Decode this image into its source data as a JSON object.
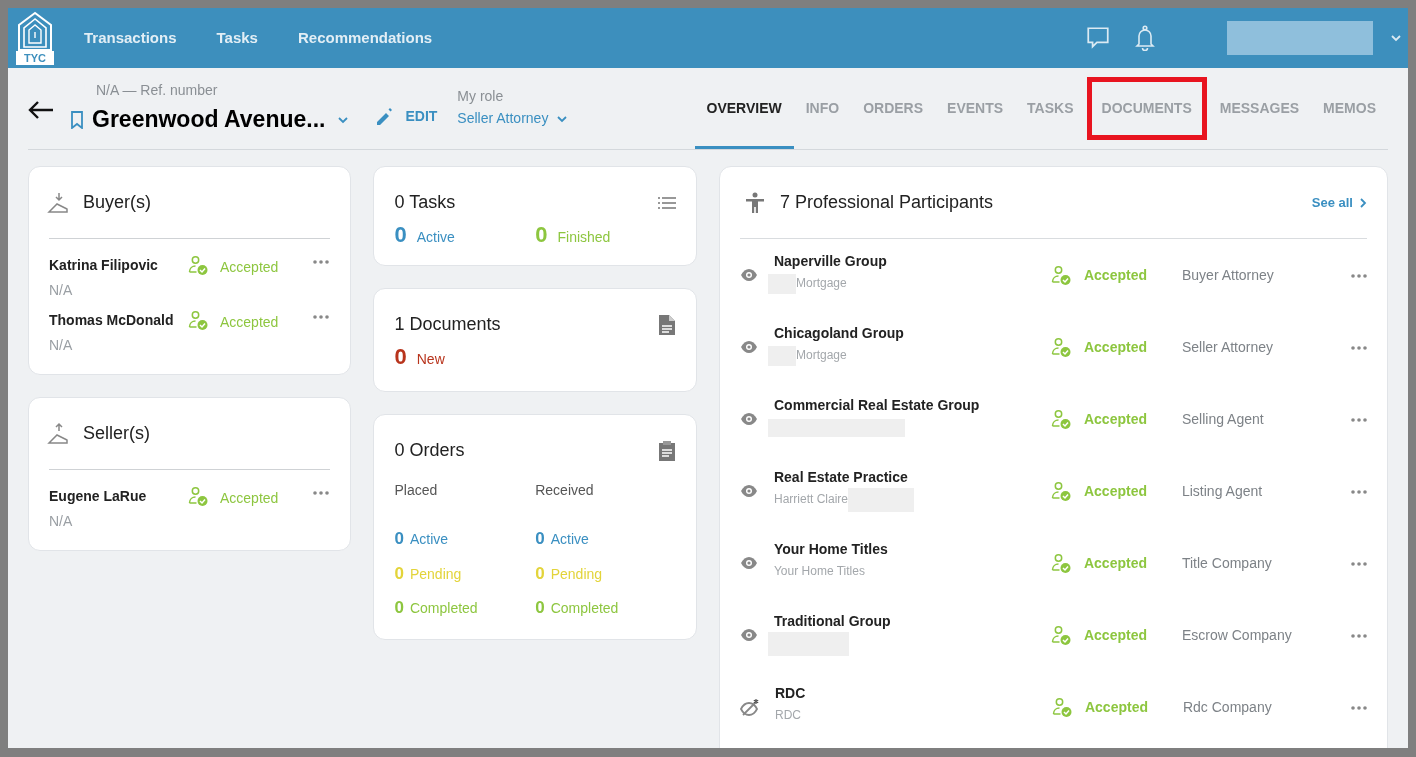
{
  "header": {
    "logo": "TYC",
    "nav": [
      "Transactions",
      "Tasks",
      "Recommendations"
    ],
    "account_redacted": true
  },
  "transaction": {
    "ref": "N/A — Ref. number",
    "title": "Greenwood Avenue...",
    "edit": "EDIT",
    "role_label": "My role",
    "role": "Seller Attorney"
  },
  "tabs": [
    {
      "label": "OVERVIEW",
      "selected": true,
      "highlighted": false
    },
    {
      "label": "INFO",
      "selected": false,
      "highlighted": false
    },
    {
      "label": "ORDERS",
      "selected": false,
      "highlighted": false
    },
    {
      "label": "EVENTS",
      "selected": false,
      "highlighted": false
    },
    {
      "label": "TASKS",
      "selected": false,
      "highlighted": false
    },
    {
      "label": "DOCUMENTS",
      "selected": false,
      "highlighted": true
    },
    {
      "label": "MESSAGES",
      "selected": false,
      "highlighted": false
    },
    {
      "label": "MEMOS",
      "selected": false,
      "highlighted": false
    }
  ],
  "parties": [
    {
      "kind": "buyer",
      "title": "Buyer(s)",
      "people": [
        {
          "name": "Katrina Filipovic",
          "detail": "N/A",
          "status": "Accepted"
        },
        {
          "name": "Thomas McDonald",
          "detail": "N/A",
          "status": "Accepted"
        }
      ]
    },
    {
      "kind": "seller",
      "title": "Seller(s)",
      "people": [
        {
          "name": "Eugene LaRue",
          "detail": "N/A",
          "status": "Accepted"
        }
      ]
    }
  ],
  "tasks": {
    "title": "0 Tasks",
    "stats": [
      {
        "count": "0",
        "label": "Active",
        "color": "#3a8fc1"
      },
      {
        "count": "0",
        "label": "Finished",
        "color": "#8dc63f"
      }
    ]
  },
  "documents": {
    "title": "1 Documents",
    "stats": [
      {
        "count": "0",
        "label": "New",
        "color": "#b8341c"
      }
    ]
  },
  "orders": {
    "title": "0 Orders",
    "columns": [
      {
        "heading": "Placed",
        "stats": [
          {
            "count": "0",
            "label": "Active",
            "color": "#3a8fc1"
          },
          {
            "count": "0",
            "label": "Pending",
            "color": "#e3d43a"
          },
          {
            "count": "0",
            "label": "Completed",
            "color": "#8dc63f"
          }
        ]
      },
      {
        "heading": "Received",
        "stats": [
          {
            "count": "0",
            "label": "Active",
            "color": "#3a8fc1"
          },
          {
            "count": "0",
            "label": "Pending",
            "color": "#e3d43a"
          },
          {
            "count": "0",
            "label": "Completed",
            "color": "#8dc63f"
          }
        ]
      }
    ]
  },
  "participants": {
    "title": "7 Professional Participants",
    "link": "See all",
    "rows": [
      {
        "name": "Naperville Group",
        "subtitle": "Mortgage",
        "kind": "prefixed",
        "visible": true,
        "status": "Accepted",
        "role": "Buyer Attorney"
      },
      {
        "name": "Chicagoland Group",
        "subtitle": "Mortgage",
        "kind": "prefixed",
        "visible": true,
        "status": "Accepted",
        "role": "Seller Attorney"
      },
      {
        "name": "Commercial Real Estate Group",
        "kind": "wide",
        "visible": true,
        "status": "Accepted",
        "role": "Selling Agent"
      },
      {
        "name": "Real Estate Practice",
        "subtitle": "Harriett Claire",
        "kind": "suffixed",
        "visible": true,
        "status": "Accepted",
        "role": "Listing Agent"
      },
      {
        "name": "Your Home Titles",
        "subtitle": "Your Home Titles",
        "kind": "plain",
        "visible": true,
        "status": "Accepted",
        "role": "Title Company"
      },
      {
        "name": "Traditional Group",
        "kind": "block",
        "visible": true,
        "status": "Accepted",
        "role": "Escrow Company"
      },
      {
        "name": "RDC",
        "subtitle": "RDC",
        "kind": "plain",
        "visible": false,
        "status": "Accepted",
        "role": "Rdc Company"
      }
    ]
  }
}
